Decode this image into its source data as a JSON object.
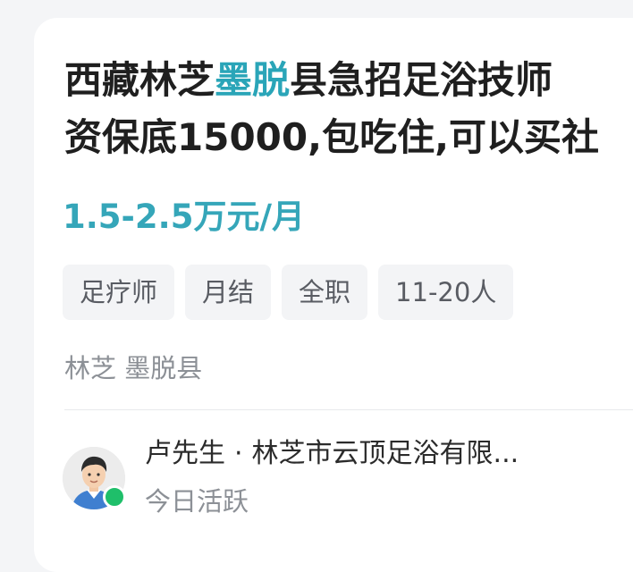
{
  "job": {
    "title_line1_prefix": "西藏林芝",
    "title_line1_highlight": "墨脱",
    "title_line1_suffix": "县急招足浴技师",
    "title_line2": "资保底15000,包吃住,可以买社",
    "salary": "1.5-2.5万元/月",
    "tags": [
      "足疗师",
      "月结",
      "全职",
      "11-20人"
    ],
    "location": "林芝 墨脱县"
  },
  "contact": {
    "name": "卢先生",
    "separator": "·",
    "company": "林芝市云顶足浴有限...",
    "status": "今日活跃"
  },
  "colors": {
    "highlight": "#2aa5b8",
    "salary": "#35a6b9",
    "online": "#1fbf6a"
  }
}
